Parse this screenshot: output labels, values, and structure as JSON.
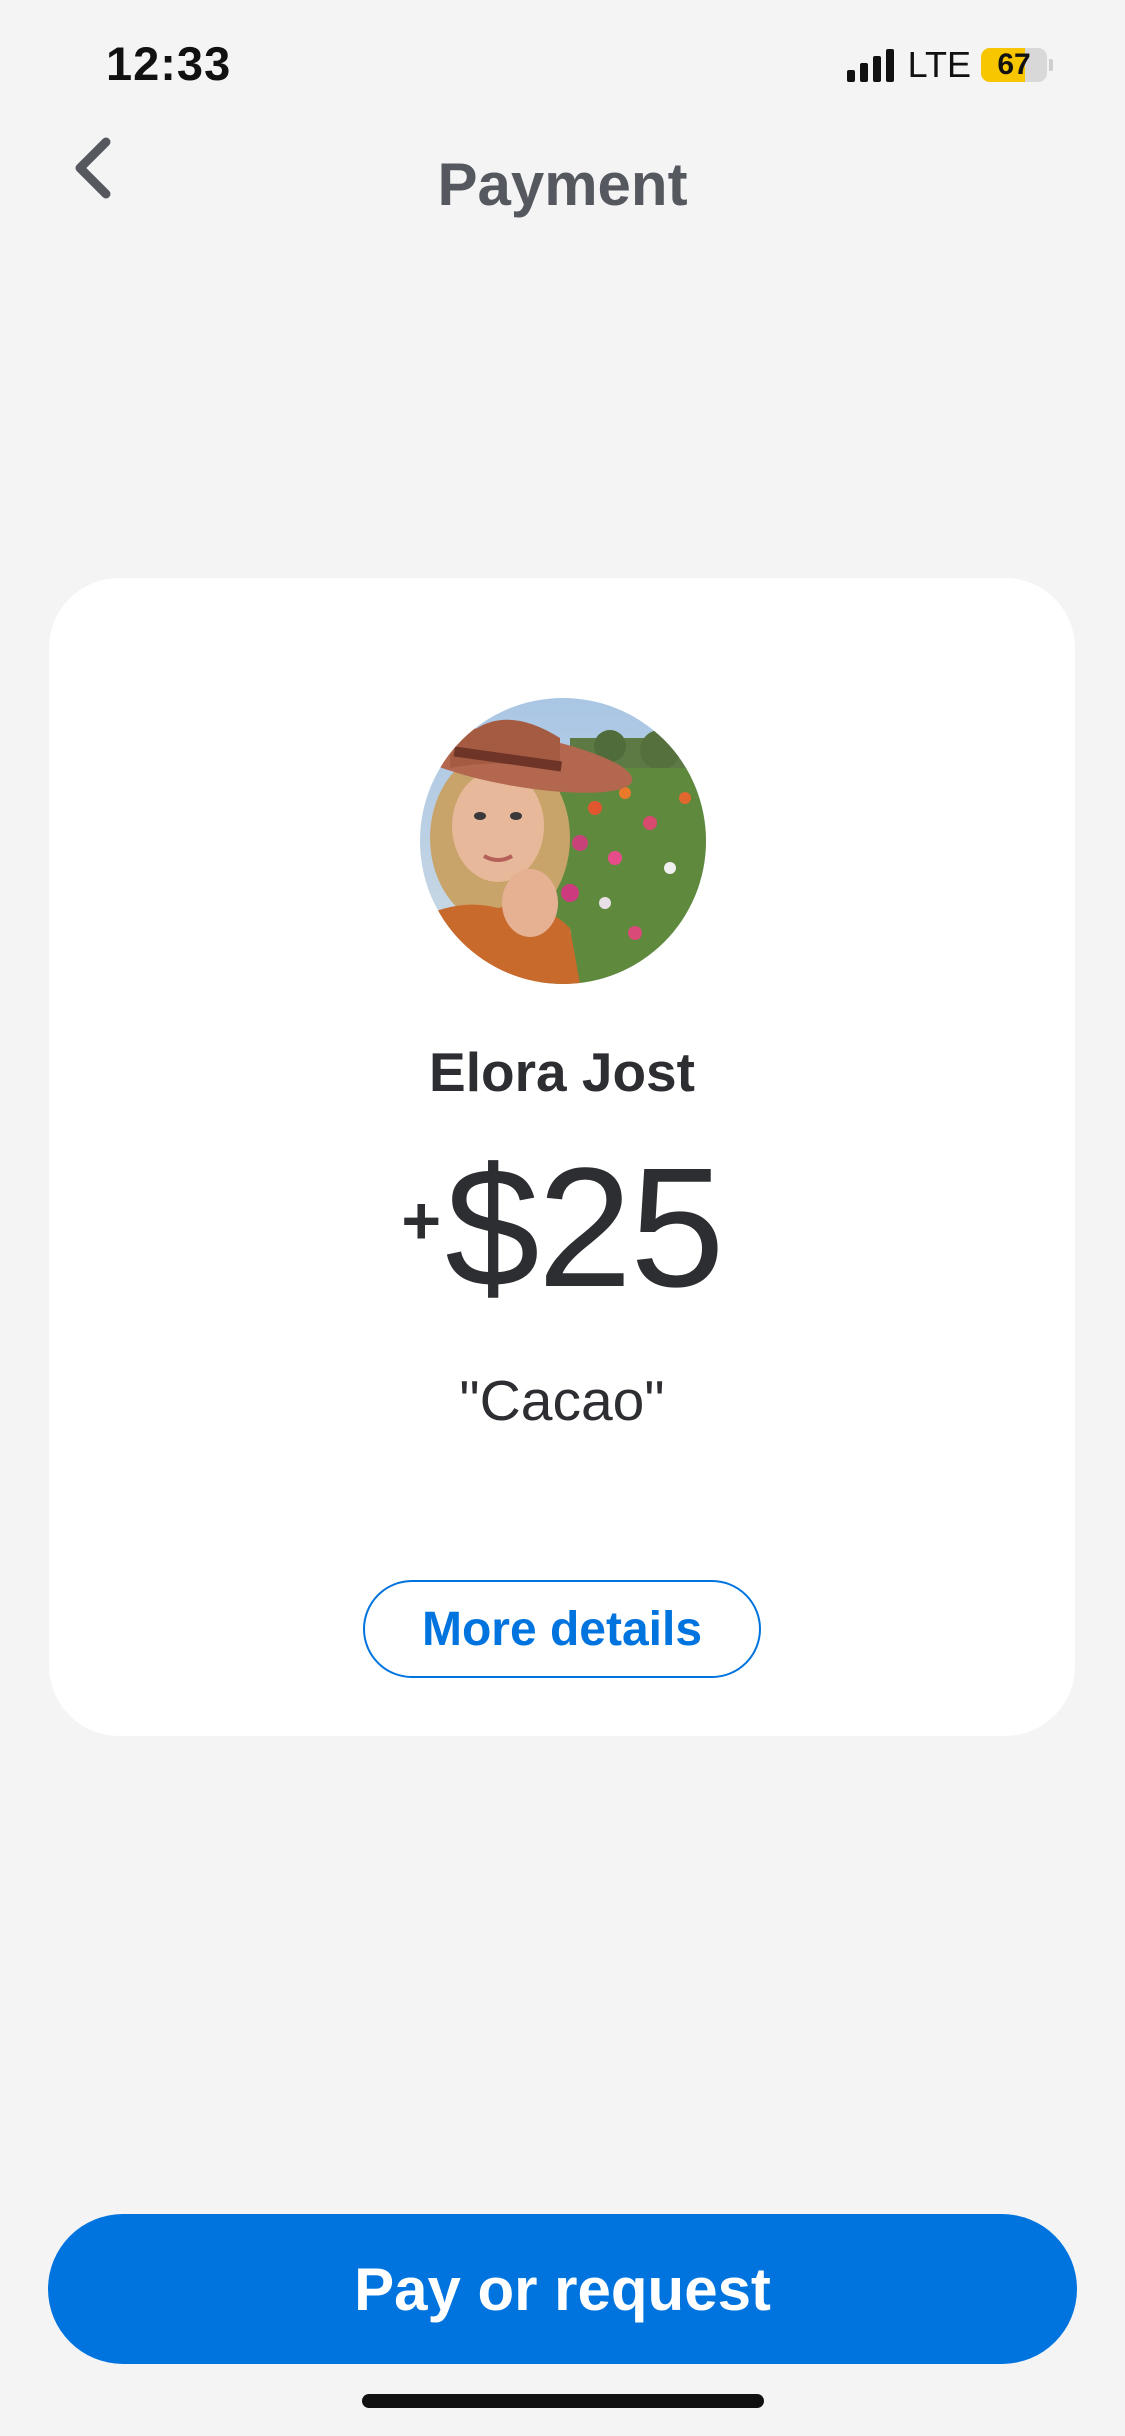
{
  "status_bar": {
    "time": "12:33",
    "network": "LTE",
    "battery_level": "67",
    "battery_fraction": 0.67,
    "signal_bars": 4
  },
  "header": {
    "title": "Payment",
    "back_icon": "chevron-left-icon"
  },
  "payment": {
    "name": "Elora Jost",
    "sign": "+",
    "amount": "$25",
    "note": "\"Cacao\"",
    "details_label": "More details"
  },
  "footer": {
    "cta_label": "Pay or request"
  },
  "colors": {
    "background": "#f4f4f5",
    "card": "#ffffff",
    "accent": "#0074de",
    "text": "#2d2e31",
    "title": "#55585e",
    "battery": "#f7c600"
  }
}
